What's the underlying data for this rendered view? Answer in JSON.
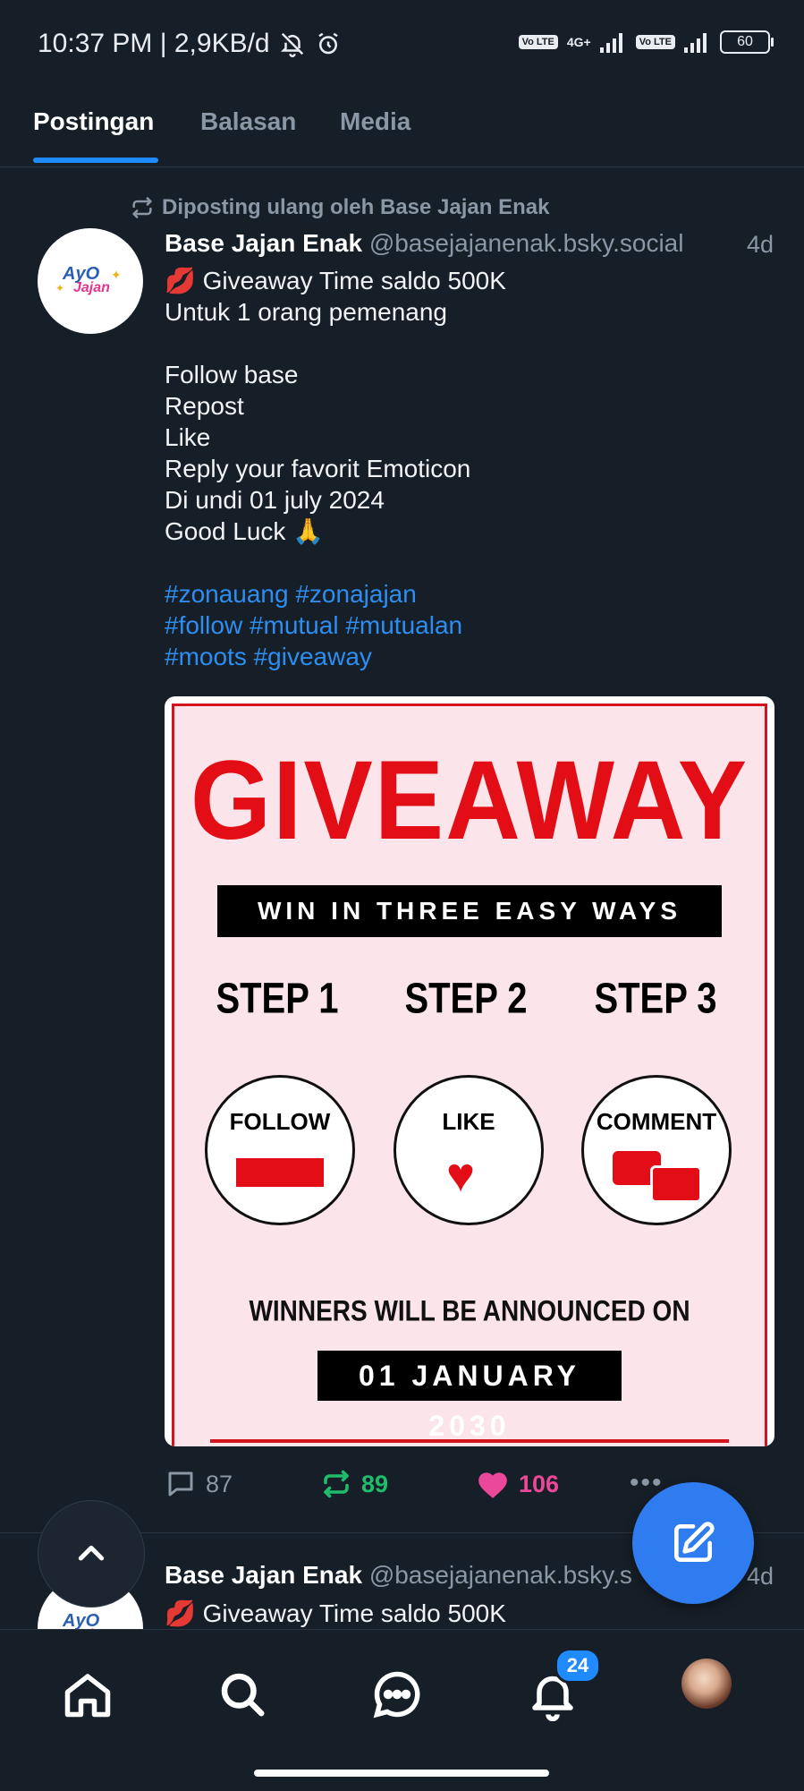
{
  "status_bar": {
    "time_info": "10:37 PM | 2,9KB/d",
    "network_label": "4G+",
    "volte_label": "Vo LTE",
    "battery": "60"
  },
  "tabs": [
    {
      "label": "Postingan",
      "active": true
    },
    {
      "label": "Balasan",
      "active": false
    },
    {
      "label": "Media",
      "active": false
    }
  ],
  "post": {
    "repost_label": "Diposting ulang oleh Base Jajan Enak",
    "author_name": "Base Jajan Enak",
    "handle": "@basejajanenak.bsky.social",
    "time": "4d",
    "lines": [
      "💋 Giveaway Time saldo 500K",
      "Untuk 1 orang pemenang",
      "",
      "Follow base",
      "Repost",
      "Like",
      "Reply your favorit Emoticon",
      "Di undi 01 july 2024",
      "Good Luck 🙏"
    ],
    "hashtag_lines": [
      "#zonauang #zonajajan",
      "#follow #mutual #mutualan",
      "#moots #giveaway"
    ],
    "avatar_text_top": "AyO",
    "avatar_text_bottom": "Jajan",
    "image": {
      "title": "GIVEAWAY",
      "banner": "WIN IN THREE EASY WAYS",
      "steps": [
        {
          "step": "STEP 1",
          "action": "FOLLOW"
        },
        {
          "step": "STEP 2",
          "action": "LIKE"
        },
        {
          "step": "STEP 3",
          "action": "COMMENT"
        }
      ],
      "announce": "WINNERS WILL BE ANNOUNCED ON",
      "date": "01 JANUARY 2030"
    },
    "reply_count": "87",
    "repost_count": "89",
    "like_count": "106",
    "more_label": "•••"
  },
  "post2": {
    "author_name": "Base Jajan Enak",
    "handle": "@basejajanenak.bsky.s",
    "time": "4d",
    "text": "💋 Giveaway Time saldo 500K"
  },
  "bottom_nav": {
    "notification_badge": "24"
  },
  "colors": {
    "background": "#161e27",
    "accent": "#1f8bff",
    "repost_green": "#20bc6c",
    "like_pink": "#ec4899",
    "hashtag_blue": "#2d8ef2"
  }
}
